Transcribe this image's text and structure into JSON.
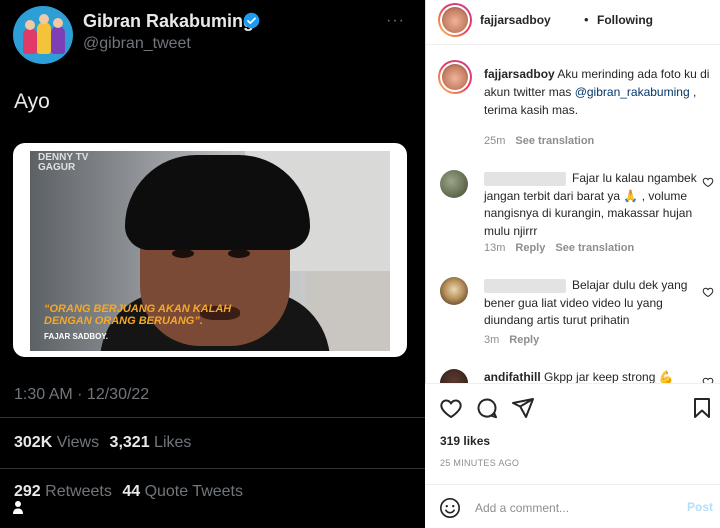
{
  "twitter": {
    "name": "Gibran Rakabuming",
    "handle": "@gibran_tweet",
    "more": "···",
    "tweet_text": "Ayo",
    "media": {
      "logo": "DENNY TV GAGUR",
      "quote": "“ORANG BERJUANG AKAN KALAH DENGAN ORANG BERUANG”.",
      "credit": "FAJAR SADBOY."
    },
    "timestamp": "1:30 AM · 12/30/22",
    "views_count": "302K",
    "views_label": "Views",
    "likes_count": "3,321",
    "likes_label": "Likes",
    "retweets_count": "292",
    "retweets_label": "Retweets",
    "quotes_count": "44",
    "quotes_label": "Quote Tweets"
  },
  "instagram": {
    "header": {
      "username": "fajjarsadboy",
      "separator": "•",
      "follow_status": "Following"
    },
    "caption": {
      "username": "fajjarsadboy",
      "text_before": " Aku merinding ada foto ku di akun twitter mas ",
      "mention": "@gibran_rakabuming",
      "text_after": " , terima kasih mas.",
      "age": "25m",
      "see_translation": "See translation"
    },
    "comments": [
      {
        "text": "Fajar lu kalau ngambek jangan terbit dari barat ya 🙏 , volume nangisnya di kurangin, makassar hujan mulu njirrr",
        "age": "13m",
        "reply": "Reply",
        "see_translation": "See translation"
      },
      {
        "text": "Belajar dulu dek yang bener gua liat video video lu yang diundang artis turut prihatin",
        "age": "3m",
        "reply": "Reply"
      },
      {
        "username": "andifathill",
        "text": "Gkpp jar keep strong 💪"
      }
    ],
    "likes": "319 likes",
    "date": "25 MINUTES AGO",
    "comment_placeholder": "Add a comment...",
    "post_label": "Post",
    "colors": {
      "link": "#00376b",
      "post_disabled": "#b2dffc",
      "muted": "#8e8e8e"
    }
  }
}
